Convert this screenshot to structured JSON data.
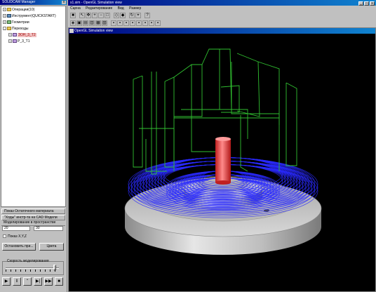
{
  "manager": {
    "title": "SOLIDCAM Manager",
    "close": "x",
    "tree": [
      {
        "label": "Операции(10)",
        "icon": "folder",
        "expand": "+",
        "indent": 0
      },
      {
        "label": "Инструмент(QUICKSTART)",
        "icon": "tool",
        "expand": "+",
        "indent": 0
      },
      {
        "label": "Геометрии",
        "icon": "geometry",
        "expand": "+",
        "indent": 0
      },
      {
        "label": "Переходы",
        "icon": "folder",
        "expand": "-",
        "indent": 0
      },
      {
        "label": "ЗОН_3_Т2",
        "icon": "operation",
        "expand": "+",
        "indent": 1,
        "selected": true
      },
      {
        "label": "P_3_T1",
        "icon": "operation",
        "expand": "+",
        "indent": 1
      }
    ]
  },
  "sim_panel": {
    "remaining_material_label": "Показ Остаточного материала",
    "tool_moves_label": "\"Ходы\" инстр-та на CAD Модели",
    "spatial_label": "Моделирование в пространстве",
    "field_1": "20",
    "field_2": "30",
    "show_xyz_label": "Показ X,Y,Z",
    "stop_button": "Остановить при...",
    "colors_button": "Цвета",
    "speed_label": "Скорость моделирования",
    "speed_value": 0.95,
    "controls": [
      "▶",
      "‖",
      "ʺ",
      "▶|",
      "▶▶",
      "■"
    ]
  },
  "app": {
    "title": "s1.sim - OpenGL Simulation view",
    "menu": [
      "Сцена",
      "Редактирование",
      "Вид",
      "Размер"
    ],
    "view_title": "OpenGL Simulation view"
  },
  "toolbar1": [
    "stop-icon",
    "sep",
    "select-icon",
    "pan-icon",
    "zoom-in-icon",
    "zoom-out-icon",
    "zoom-fit-icon",
    "sep",
    "wireframe-icon",
    "shaded-icon",
    "sep",
    "rotate-icon",
    "measure-icon",
    "sep",
    "help-icon"
  ],
  "toolbar2": [
    "view-iso-icon",
    "view-top-icon",
    "view-front-icon",
    "view-side-icon",
    "view-back-icon",
    "view-bottom-icon",
    "sep",
    "box1-icon",
    "box2-icon",
    "box3-icon",
    "box4-icon",
    "box5-icon",
    "box6-icon",
    "box7-icon",
    "box8-icon"
  ],
  "colors": {
    "toolpath_blue": "#2a2aff",
    "rapid_green": "#30c030",
    "tool_red": "#e04040",
    "part_gray": "#c8c8c8",
    "background": "#000000"
  }
}
